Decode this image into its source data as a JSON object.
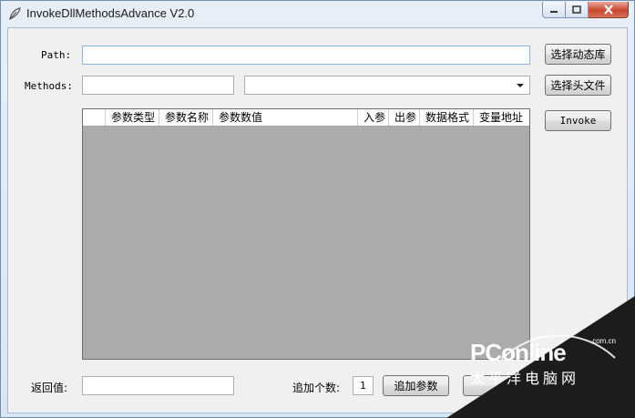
{
  "window": {
    "title": "InvokeDllMethodsAdvance V2.0"
  },
  "form": {
    "path_label": "Path:",
    "path_value": "",
    "methods_label": "Methods:",
    "methods_value": "",
    "methods_combo_value": "",
    "select_dll_button": "选择动态库",
    "select_header_button": "选择头文件",
    "invoke_button": "Invoke",
    "return_label": "返回值:",
    "return_value": "",
    "add_count_label": "追加个数:",
    "add_count_value": "1",
    "add_param_button": "追加参数"
  },
  "grid": {
    "columns": [
      "参数类型",
      "参数名称",
      "参数数值",
      "入参",
      "出参",
      "数据格式",
      "变量地址"
    ]
  },
  "watermark": {
    "brand": "PConline",
    "domain": ".com.cn",
    "subtitle": "太平洋电脑网"
  },
  "colors": {
    "accent": "#7eb4ea",
    "grid_background": "#ababab",
    "close_button": "#c9462c"
  }
}
